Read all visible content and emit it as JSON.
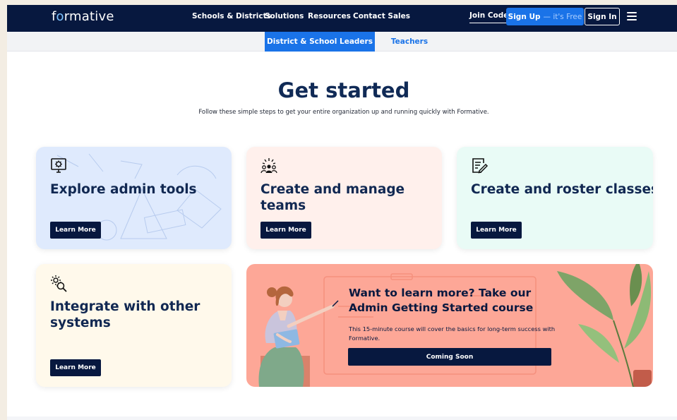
{
  "header": {
    "logo": "formative",
    "nav": [
      "Schools & Districts",
      "Solutions",
      "Resources",
      "Contact Sales"
    ],
    "join_code": "Join Code",
    "signup_label": "Sign Up",
    "signup_suffix": "— it's Free",
    "signin_label": "Sign In",
    "menu_icon": "hamburger-menu-icon"
  },
  "subnav": {
    "tabs": [
      "District & School Leaders",
      "Teachers"
    ],
    "active": "District & School Leaders"
  },
  "main": {
    "title": "Get started",
    "subtitle": "Follow these simple steps to get your entire organization up and running quickly with Formative."
  },
  "cards": [
    {
      "title": "Explore admin tools",
      "button": "Learn More",
      "icon": "monitor-gear-icon"
    },
    {
      "title": "Create and manage teams",
      "button": "Learn More",
      "icon": "team-icon"
    },
    {
      "title": "Create and roster classes",
      "button": "Learn More",
      "icon": "edit-document-icon"
    },
    {
      "title": "Integrate with other systems",
      "button": "Learn More",
      "icon": "gear-search-icon"
    }
  ],
  "banner": {
    "title": "Want to learn more? Take our Admin Getting Started course",
    "text": "This 15-minute course will cover the basics for long-term success with Formative.",
    "button": "Coming Soon"
  },
  "colors": {
    "navy": "#07183f",
    "blue": "#1a73e8",
    "banner": "#fda797"
  }
}
